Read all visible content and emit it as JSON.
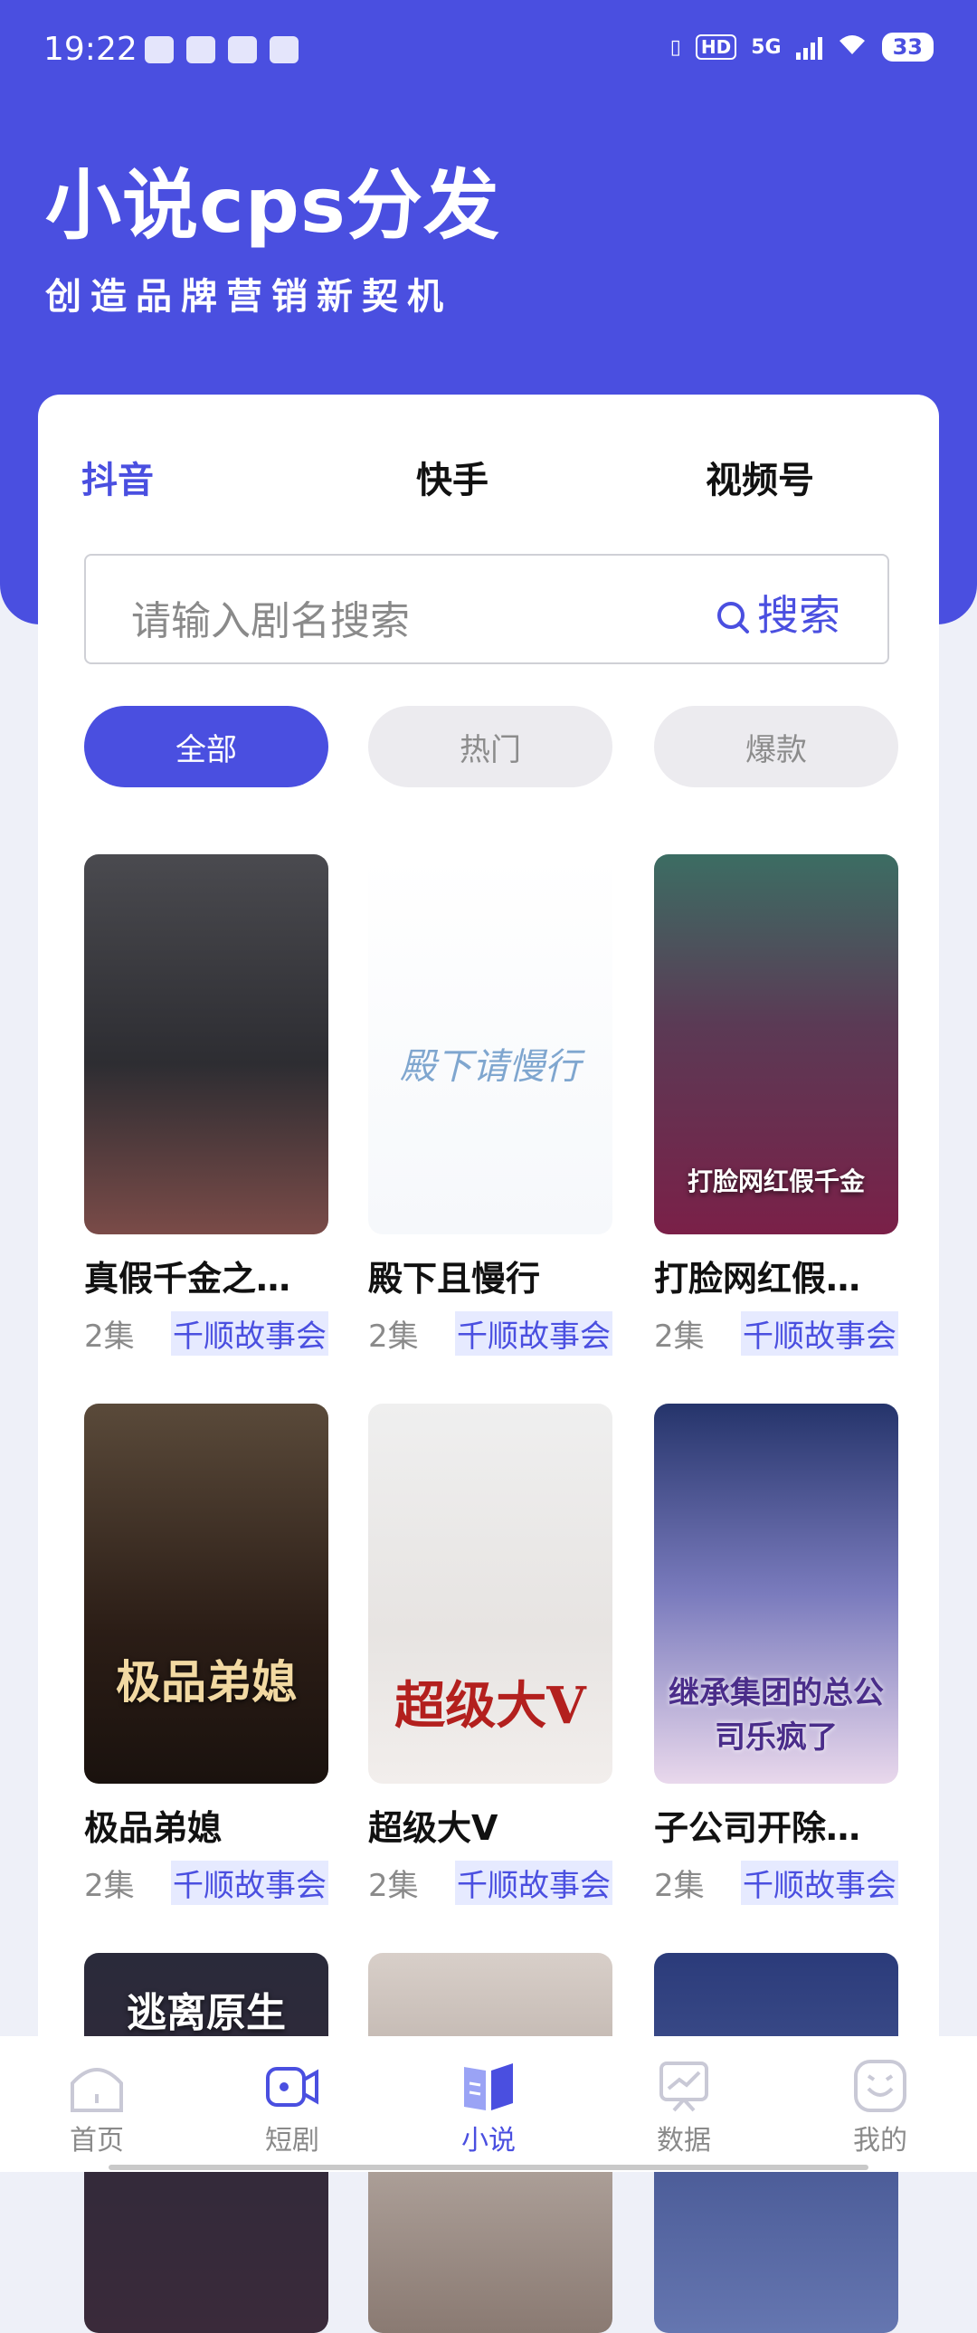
{
  "status_bar": {
    "time": "19:22",
    "network": "5G",
    "hd": "HD",
    "battery": "33"
  },
  "header": {
    "title": "小说cps分发",
    "subtitle": "创造品牌营销新契机"
  },
  "platform_tabs": [
    {
      "label": "抖音",
      "active": true
    },
    {
      "label": "快手",
      "active": false
    },
    {
      "label": "视频号",
      "active": false
    }
  ],
  "search": {
    "placeholder": "请输入剧名搜索",
    "button_label": "搜索"
  },
  "filters": [
    {
      "label": "全部",
      "active": true
    },
    {
      "label": "热门",
      "active": false
    },
    {
      "label": "爆款",
      "active": false
    }
  ],
  "books": [
    {
      "title": "真假千金之…",
      "episodes": "2集",
      "publisher": "千顺故事会",
      "cover_text": ""
    },
    {
      "title": "殿下且慢行",
      "episodes": "2集",
      "publisher": "千顺故事会",
      "cover_text": "殿下请慢行"
    },
    {
      "title": "打脸网红假…",
      "episodes": "2集",
      "publisher": "千顺故事会",
      "cover_text": "打脸网红假千金"
    },
    {
      "title": "极品弟媳",
      "episodes": "2集",
      "publisher": "千顺故事会",
      "cover_text": "极品弟媳"
    },
    {
      "title": "超级大V",
      "episodes": "2集",
      "publisher": "千顺故事会",
      "cover_text": "超级大V"
    },
    {
      "title": "子公司开除…",
      "episodes": "2集",
      "publisher": "千顺故事会",
      "cover_text": "继承集团的总公司乐疯了"
    },
    {
      "title": "",
      "episodes": "",
      "publisher": "",
      "cover_text": "逃离原生"
    },
    {
      "title": "",
      "episodes": "",
      "publisher": "",
      "cover_text": ""
    },
    {
      "title": "",
      "episodes": "",
      "publisher": "",
      "cover_text": ""
    }
  ],
  "bottom_nav": [
    {
      "label": "首页",
      "icon": "home-icon",
      "active": false
    },
    {
      "label": "短剧",
      "icon": "video-camera-icon",
      "active": false
    },
    {
      "label": "小说",
      "icon": "book-icon",
      "active": true
    },
    {
      "label": "数据",
      "icon": "chart-icon",
      "active": false
    },
    {
      "label": "我的",
      "icon": "smile-face-icon",
      "active": false
    }
  ],
  "colors": {
    "brand": "#4a4fe0",
    "publisher_bg": "#e6eaff"
  }
}
